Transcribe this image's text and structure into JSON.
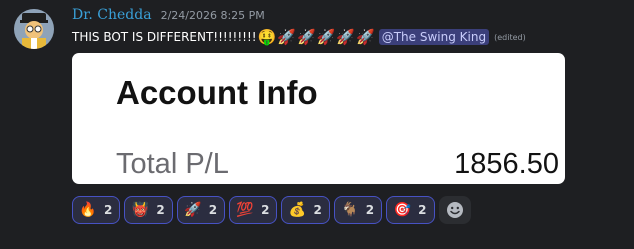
{
  "message": {
    "author": "Dr. Chedda",
    "timestamp": "2/24/2026 8:25 PM",
    "text": "THIS BOT IS DIFFERENT!!!!!!!!!",
    "inline_emojis": [
      "🤑",
      "🚀",
      "🚀",
      "🚀",
      "🚀",
      "🚀"
    ],
    "mention": "@The Swing King",
    "edited_label": "(edited)"
  },
  "embed": {
    "title": "Account Info",
    "rows": [
      {
        "label": "Total P/L",
        "value": "1856.50"
      }
    ]
  },
  "reactions": [
    {
      "emoji": "🔥",
      "count": "2",
      "icon": "fire-icon"
    },
    {
      "emoji": "👹",
      "count": "2",
      "icon": "demon-mask-icon"
    },
    {
      "emoji": "🚀",
      "count": "2",
      "icon": "rocket-icon"
    },
    {
      "emoji": "💯",
      "count": "2",
      "icon": "hundred-points-icon"
    },
    {
      "emoji": "💰",
      "count": "2",
      "icon": "money-bag-icon"
    },
    {
      "emoji": "🐐",
      "count": "2",
      "icon": "goat-icon"
    },
    {
      "emoji": "🎯",
      "count": "2",
      "icon": "bullseye-icon"
    }
  ],
  "colors": {
    "background": "#1e1f22",
    "username": "#3aa0d8",
    "mention_bg": "#3b3f7a",
    "reaction_border": "#4752c4"
  }
}
